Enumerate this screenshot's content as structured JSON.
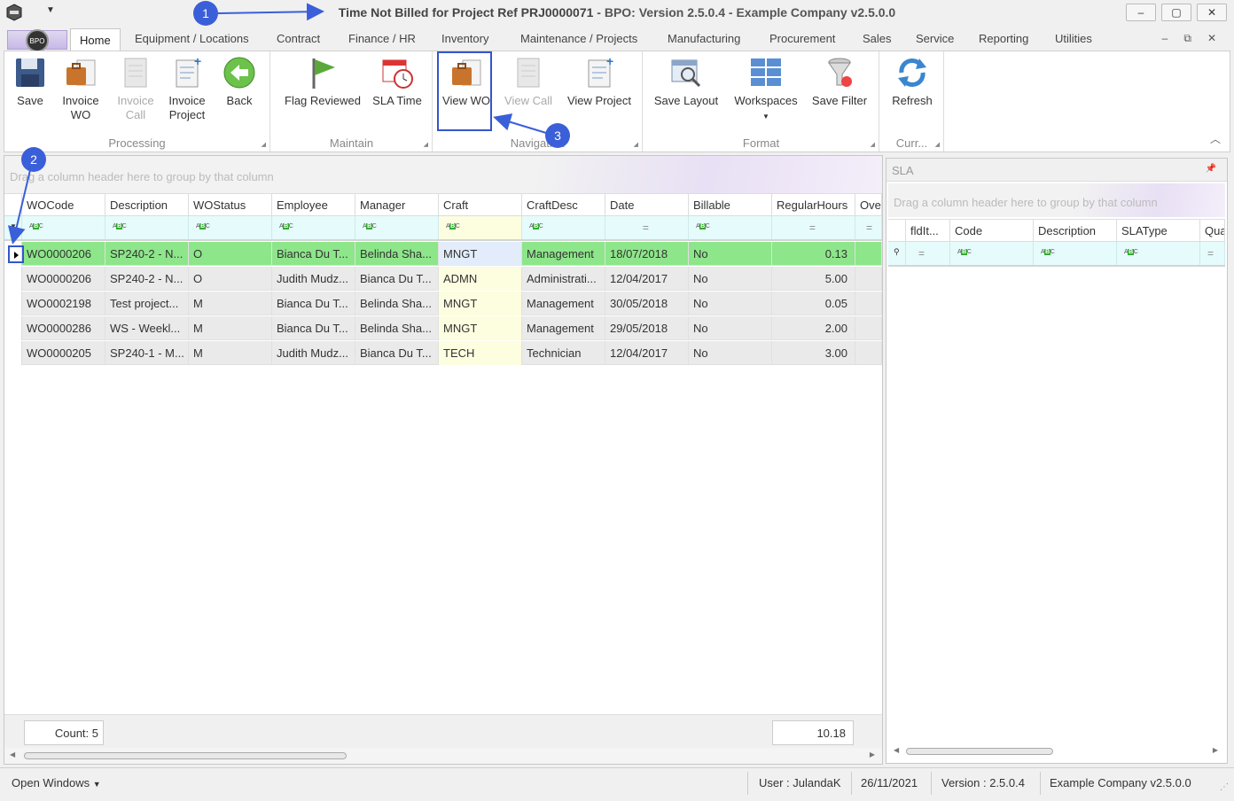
{
  "window": {
    "title_main": "Time Not Billed for Project Ref PRJ0000071",
    "title_rest": " - BPO: Version 2.5.0.4 - Example Company v2.5.0.0",
    "minimize": "–",
    "maximize": "▢",
    "close": "✕"
  },
  "tabs": [
    "Home",
    "Equipment / Locations",
    "Contract",
    "Finance / HR",
    "Inventory",
    "Maintenance / Projects",
    "Manufacturing",
    "Procurement",
    "Sales",
    "Service",
    "Reporting",
    "Utilities"
  ],
  "tab_controls": {
    "min": "–",
    "restore": "⧉",
    "close": "✕"
  },
  "ribbon": {
    "processing": {
      "label": "Processing",
      "save": "Save",
      "invoice_wo": [
        "Invoice",
        "WO"
      ],
      "invoice_call": [
        "Invoice",
        "Call"
      ],
      "invoice_project": [
        "Invoice",
        "Project"
      ],
      "back": "Back"
    },
    "maintain": {
      "label": "Maintain",
      "flag_reviewed": "Flag Reviewed",
      "sla_time": "SLA Time"
    },
    "navigation": {
      "label": "Navigation",
      "view_wo": "View WO",
      "view_call": "View Call",
      "view_project": "View Project"
    },
    "format": {
      "label": "Format",
      "save_layout": "Save Layout",
      "workspaces": "Workspaces",
      "save_filter": "Save Filter"
    },
    "currency": {
      "label": "Curr...",
      "refresh": "Refresh"
    }
  },
  "grid": {
    "group_hint": "Drag a column header here to group by that column",
    "columns": [
      "WOCode",
      "Description",
      "WOStatus",
      "Employee",
      "Manager",
      "Craft",
      "CraftDesc",
      "Date",
      "Billable",
      "RegularHours",
      "Over"
    ],
    "rows": [
      [
        "WO0000206",
        "SP240-2 - N...",
        "O",
        "Bianca Du T...",
        "Belinda Sha...",
        "MNGT",
        "Management",
        "18/07/2018",
        "No",
        "0.13"
      ],
      [
        "WO0000206",
        "SP240-2 - N...",
        "O",
        "Judith Mudz...",
        "Bianca Du T...",
        "ADMN",
        "Administrati...",
        "12/04/2017",
        "No",
        "5.00"
      ],
      [
        "WO0002198",
        "Test project...",
        "M",
        "Bianca Du T...",
        "Belinda Sha...",
        "MNGT",
        "Management",
        "30/05/2018",
        "No",
        "0.05"
      ],
      [
        "WO0000286",
        "WS - Weekl...",
        "M",
        "Bianca Du T...",
        "Belinda Sha...",
        "MNGT",
        "Management",
        "29/05/2018",
        "No",
        "2.00"
      ],
      [
        "WO0000205",
        "SP240-1 - M...",
        "M",
        "Judith Mudz...",
        "Bianca Du T...",
        "TECH",
        "Technician",
        "12/04/2017",
        "No",
        "3.00"
      ]
    ],
    "count": "Count: 5",
    "total": "10.18"
  },
  "sla": {
    "title": "SLA",
    "group_hint": "Drag a column header here to group by that column",
    "columns": [
      "fldIt...",
      "Code",
      "Description",
      "SLAType",
      "Qua"
    ]
  },
  "status": {
    "open_windows": "Open Windows",
    "user": "User : JulandaK",
    "date": "26/11/2021",
    "version": "Version : 2.5.0.4",
    "company": "Example Company v2.5.0.0"
  },
  "annotations": [
    "1",
    "2",
    "3"
  ],
  "colors": {
    "selected_row": "#8de68a",
    "craft_column": "#fdfde0",
    "filter_row": "#e6fbfb",
    "annotation": "#3a5fd9"
  }
}
